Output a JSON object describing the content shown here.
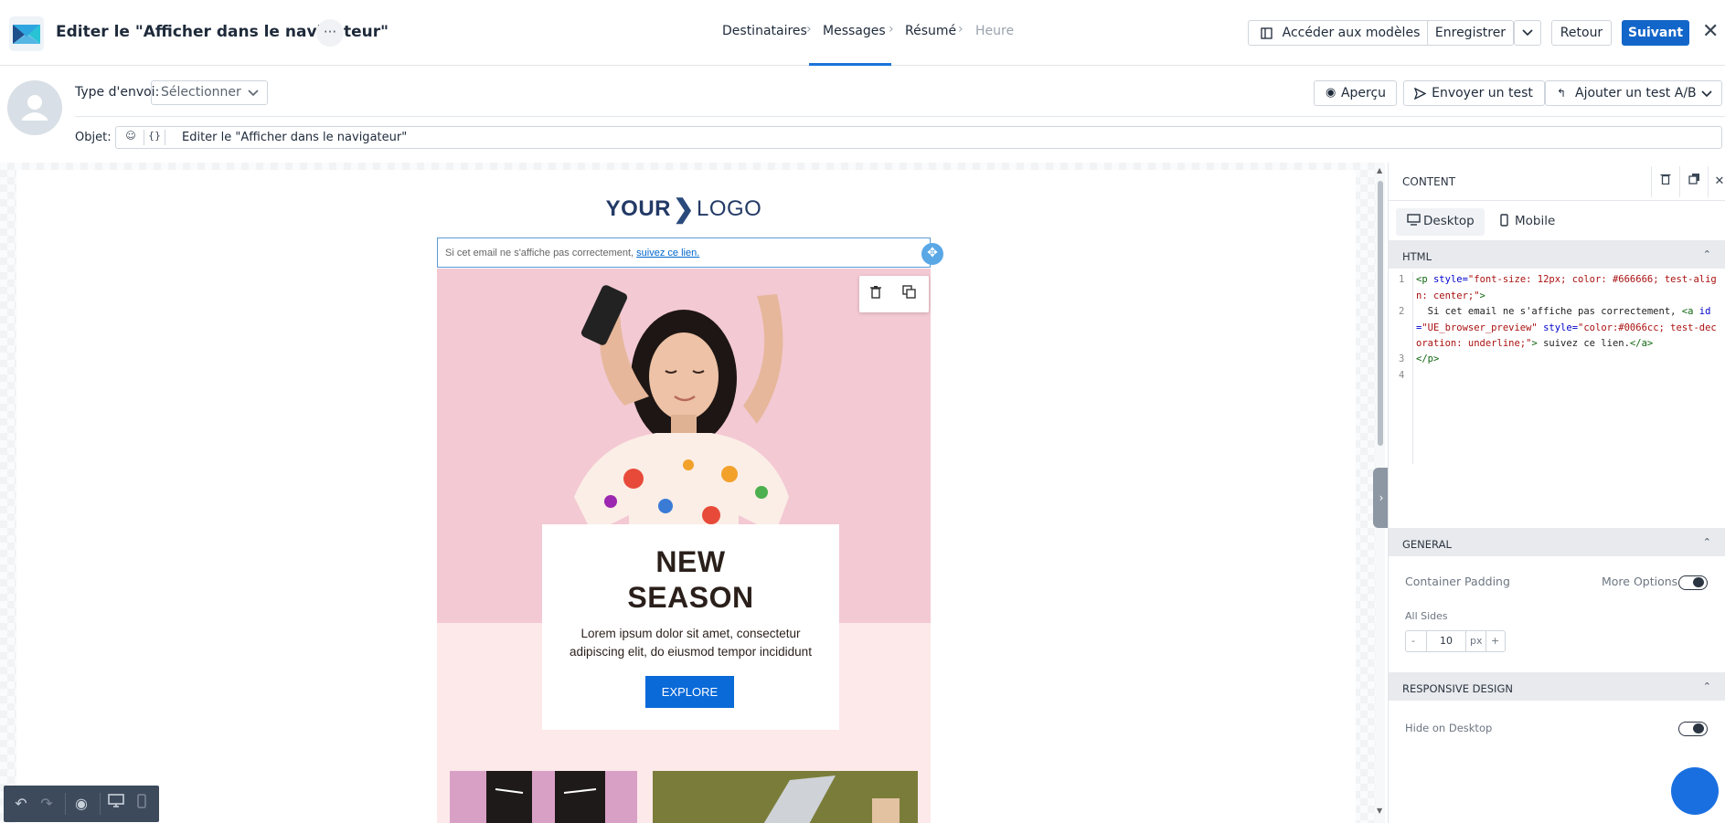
{
  "header": {
    "title": "Editer le \"Afficher dans le navigateur\"",
    "more_label": "···",
    "steps": [
      {
        "label": "Destinataires"
      },
      {
        "label": "Messages"
      },
      {
        "label": "Résumé"
      },
      {
        "label": "Heure"
      }
    ],
    "step_separator": "›",
    "templates_label": "Accéder aux modèles",
    "save_label": "Enregistrer",
    "back_label": "Retour",
    "next_label": "Suivant",
    "close_label": "✕"
  },
  "settings": {
    "send_type_label": "Type d'envoi:",
    "send_type_value": "Sélectionner",
    "preview_label": "Aperçu",
    "send_test_label": "Envoyer un test",
    "ab_test_label": "Ajouter un test A/B",
    "subject_label": "Objet:",
    "subject_value": "Editer le \"Afficher dans le navigateur\"",
    "emoji_icon": "☺",
    "merge_icon": "{}"
  },
  "email": {
    "logo_your": "YOUR",
    "logo_logo": "LOGO",
    "preview_text": "Si cet email ne s'affiche pas correctement, ",
    "preview_link": "suivez ce lien.",
    "hero_title_1": "NEW",
    "hero_title_2": "SEASON",
    "hero_text": "Lorem ipsum dolor sit amet, consectetur adipiscing elit, do eiusmod tempor incididunt",
    "cta_label": "EXPLORE"
  },
  "panel": {
    "title": "CONTENT",
    "tab_desktop": "Desktop",
    "tab_mobile": "Mobile",
    "section_html": "HTML",
    "code_lines": [
      "1",
      "2",
      "3",
      "4"
    ],
    "section_general": "GENERAL",
    "container_padding": "Container Padding",
    "more_options": "More Options",
    "all_sides": "All Sides",
    "padding_minus": "-",
    "padding_value": "10",
    "padding_unit": "px",
    "padding_plus": "+",
    "section_responsive": "RESPONSIVE DESIGN",
    "hide_on_desktop": "Hide on Desktop"
  },
  "colors": {
    "accent": "#1366c9",
    "link": "#0066cc",
    "hero_pink": "#f3c9d4",
    "cta": "#0a6ad8"
  }
}
